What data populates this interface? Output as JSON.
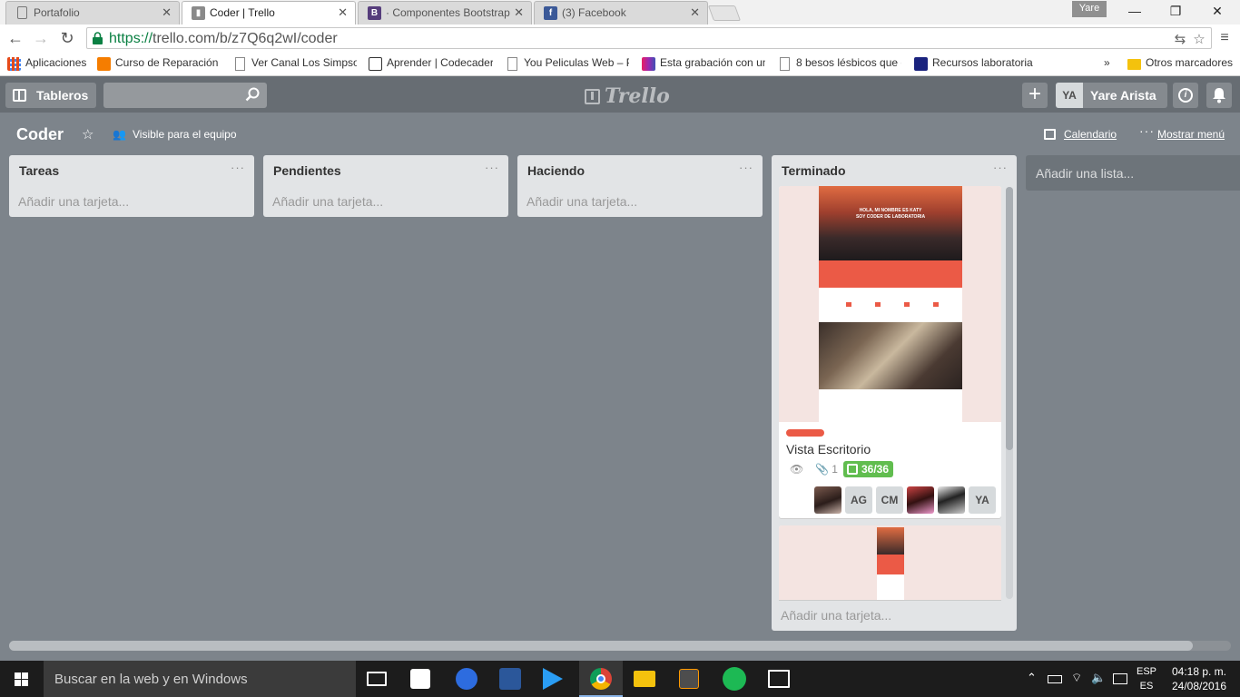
{
  "browser": {
    "tabs": [
      {
        "title": "Portafolio",
        "active": false
      },
      {
        "title": "Coder | Trello",
        "active": true
      },
      {
        "title": "· Componentes Bootstrap",
        "active": false
      },
      {
        "title": "(3) Facebook",
        "active": false
      }
    ],
    "profile": "Yare",
    "url_scheme": "https://",
    "url_rest": "trello.com/b/z7Q6q2wI/coder",
    "bookmarks": [
      {
        "label": "Aplicaciones"
      },
      {
        "label": "Curso de Reparación d"
      },
      {
        "label": "Ver Canal Los Simpsor"
      },
      {
        "label": "Aprender | Codecader"
      },
      {
        "label": "You Peliculas Web – Pe"
      },
      {
        "label": "Esta grabación con un"
      },
      {
        "label": "8 besos lésbicos que c"
      },
      {
        "label": "Recursos laboratoria"
      }
    ],
    "other_bookmarks": "Otros marcadores"
  },
  "trello": {
    "boards_button": "Tableros",
    "logo": "Trello",
    "user": {
      "initials": "YA",
      "name": "Yare Arista"
    },
    "board": {
      "name": "Coder",
      "visibility": "Visible para el equipo",
      "calendar": "Calendario",
      "show_menu": "Mostrar menú"
    },
    "lists": [
      {
        "name": "Tareas",
        "add_card": "Añadir una tarjeta..."
      },
      {
        "name": "Pendientes",
        "add_card": "Añadir una tarjeta..."
      },
      {
        "name": "Haciendo",
        "add_card": "Añadir una tarjeta..."
      },
      {
        "name": "Terminado",
        "add_card": "Añadir una tarjeta..."
      }
    ],
    "add_list": "Añadir una lista...",
    "card": {
      "title": "Vista Escritorio",
      "attachments": "1",
      "checklist": "36/36",
      "label_color": "#eb5a46",
      "members": [
        "photo",
        "AG",
        "CM",
        "photo",
        "photo",
        "YA"
      ],
      "preview_text_1": "HOLA, MI NOMBRE ES KATY",
      "preview_text_2": "SOY CODER DE LABORATORIA"
    }
  },
  "taskbar": {
    "search_placeholder": "Buscar en la web y en Windows",
    "lang_1": "ESP",
    "lang_2": "ES",
    "time": "04:18 p. m.",
    "date": "24/08/2016"
  }
}
